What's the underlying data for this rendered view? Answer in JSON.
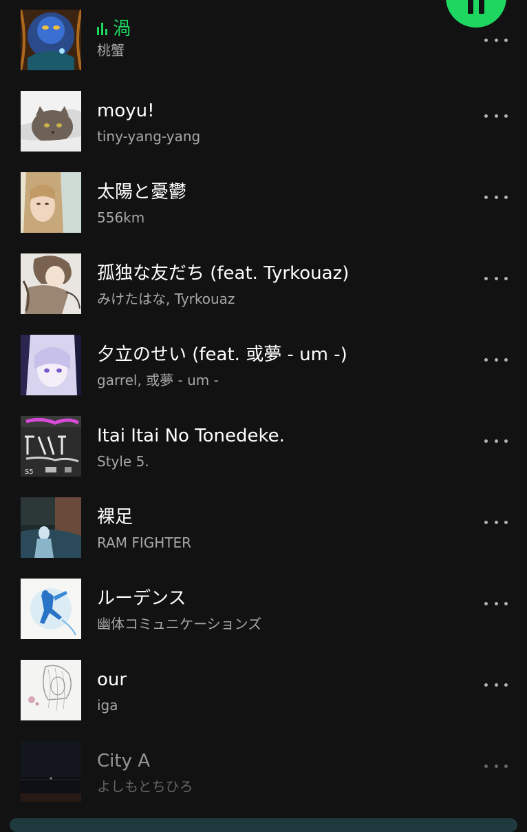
{
  "controls": {
    "play_pause_state": "playing",
    "play_pause_icon": "pause-icon",
    "accent_color": "#1ed760"
  },
  "tracks": [
    {
      "title": "渦",
      "artist": "桃蟹",
      "now_playing": true,
      "cover_icon": "album-cover-blue-fantasy"
    },
    {
      "title": "moyu!",
      "artist": "tiny-yang-yang",
      "now_playing": false,
      "cover_icon": "album-cover-cat"
    },
    {
      "title": "太陽と憂鬱",
      "artist": "556km",
      "now_playing": false,
      "cover_icon": "album-cover-portrait"
    },
    {
      "title": "孤独な友だち (feat. Tyrkouaz)",
      "artist": "みけたはな, Tyrkouaz",
      "now_playing": false,
      "cover_icon": "album-cover-illustration"
    },
    {
      "title": "夕立のせい (feat. 或夢 - um -)",
      "artist": "garrel, 或夢 - um -",
      "now_playing": false,
      "cover_icon": "album-cover-anime-girl"
    },
    {
      "title": "Itai Itai No Tonedeke.",
      "artist": "Style 5.",
      "now_playing": false,
      "cover_icon": "album-cover-graffiti"
    },
    {
      "title": "裸足",
      "artist": "RAM FIGHTER",
      "now_playing": false,
      "cover_icon": "album-cover-dark-photo"
    },
    {
      "title": "ルーデンス",
      "artist": "幽体コミュニケーションズ",
      "now_playing": false,
      "cover_icon": "album-cover-blue-figure"
    },
    {
      "title": "our",
      "artist": "iga",
      "now_playing": false,
      "cover_icon": "album-cover-sketch"
    },
    {
      "title": "City A",
      "artist": "よしもとちひろ",
      "now_playing": false,
      "cover_icon": "album-cover-night-city"
    }
  ]
}
